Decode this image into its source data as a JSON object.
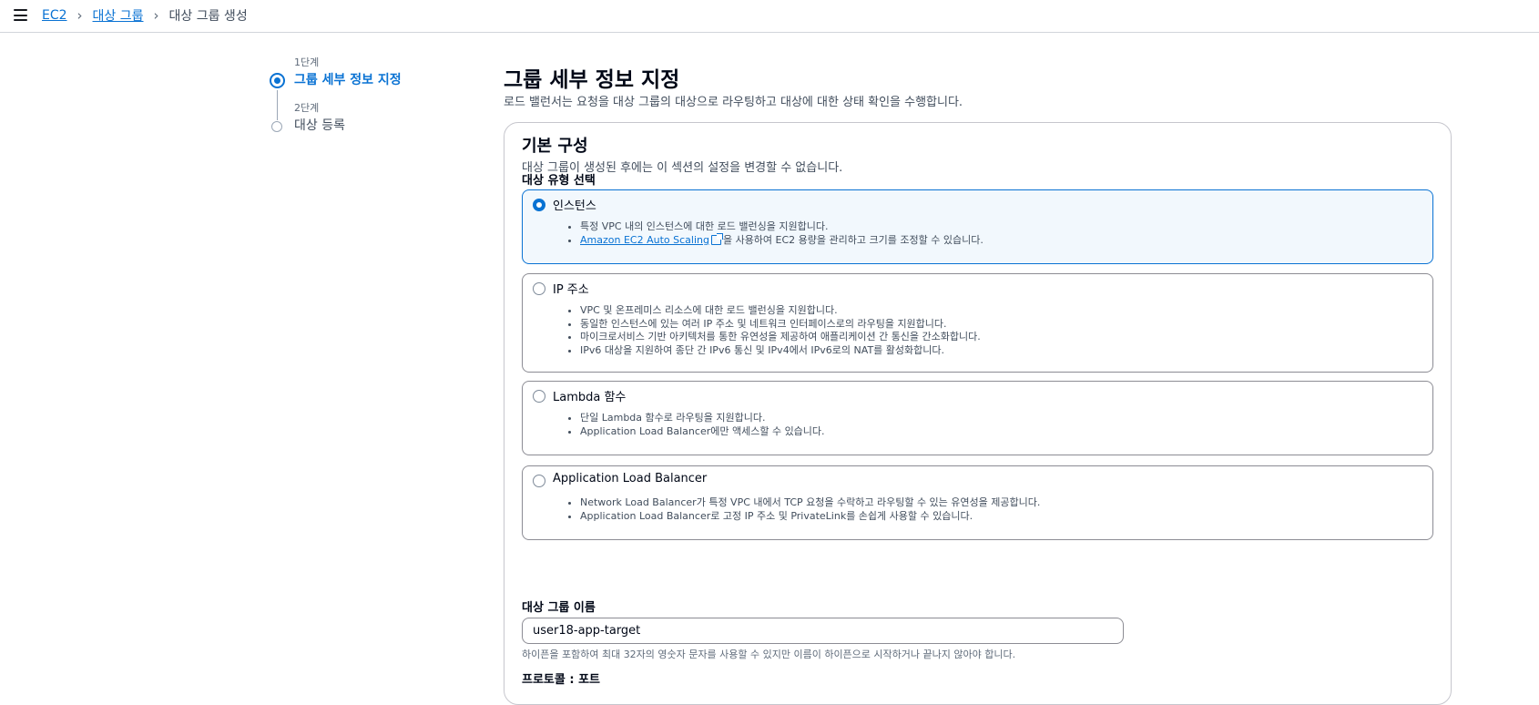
{
  "breadcrumb": {
    "items": [
      "EC2",
      "대상 그룹"
    ],
    "current": "대상 그룹 생성"
  },
  "steps": [
    {
      "number": "1단계",
      "title": "그룹 세부 정보 지정"
    },
    {
      "number": "2단계",
      "title": "대상 등록"
    }
  ],
  "page": {
    "title": "그룹 세부 정보 지정",
    "description": "로드 밸런서는 요청을 대상 그룹의 대상으로 라우팅하고 대상에 대한 상태 확인을 수행합니다."
  },
  "basic_config": {
    "title": "기본 구성",
    "description": "대상 그룹이 생성된 후에는 이 섹션의 설정을 변경할 수 없습니다.",
    "target_type_label": "대상 유형 선택",
    "options": [
      {
        "title": "인스턴스",
        "bullets": [
          "특정 VPC 내의 인스턴스에 대한 로드 밸런싱을 지원합니다."
        ],
        "link_text": "Amazon EC2 Auto Scaling",
        "link_suffix": "을 사용하여 EC2 용량을 관리하고 크기를 조정할 수 있습니다."
      },
      {
        "title": "IP 주소",
        "bullets": [
          "VPC 및 온프레미스 리소스에 대한 로드 밸런싱을 지원합니다.",
          "동일한 인스턴스에 있는 여러 IP 주소 및 네트워크 인터페이스로의 라우팅을 지원합니다.",
          "마이크로서비스 기반 아키텍처를 통한 유연성을 제공하여 애플리케이션 간 통신을 간소화합니다.",
          "IPv6 대상을 지원하여 종단 간 IPv6 통신 및 IPv4에서 IPv6로의 NAT를 활성화합니다."
        ]
      },
      {
        "title": "Lambda 함수",
        "bullets": [
          "단일 Lambda 함수로 라우팅을 지원합니다.",
          "Application Load Balancer에만 액세스할 수 있습니다."
        ]
      },
      {
        "title": "Application Load Balancer",
        "bullets": [
          "Network Load Balancer가 특정 VPC 내에서 TCP 요청을 수락하고 라우팅할 수 있는 유연성을 제공합니다.",
          "Application Load Balancer로 고정 IP 주소 및 PrivateLink를 손쉽게 사용할 수 있습니다."
        ]
      }
    ],
    "name_label": "대상 그룹 이름",
    "name_value": "user18-app-target",
    "name_help": "하이픈을 포함하여 최대 32자의 영숫자 문자를 사용할 수 있지만 이름이 하이픈으로 시작하거나 끝나지 않아야 합니다.",
    "protocol_label": "프로토콜 : 포트"
  },
  "colors": {
    "accent": "#0972d3",
    "selected_bg": "#f2f8fd",
    "border": "#8c8c94"
  }
}
